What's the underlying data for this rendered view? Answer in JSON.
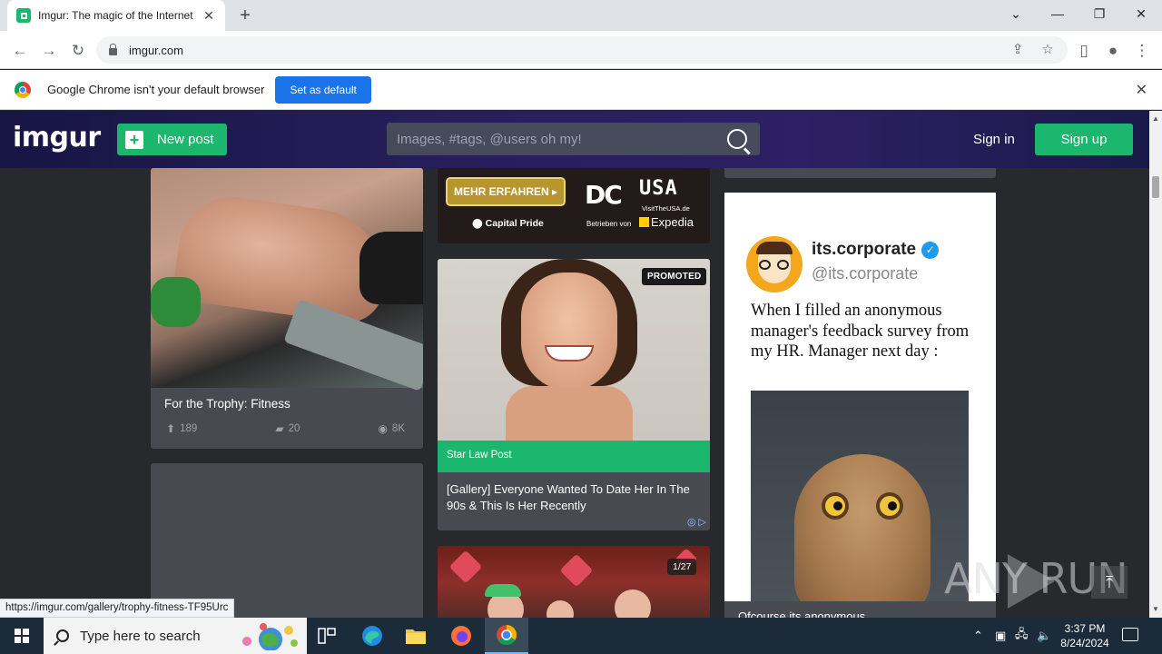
{
  "browser": {
    "tab_title": "Imgur: The magic of the Internet",
    "url": "imgur.com",
    "infobar_text": "Google Chrome isn't your default browser",
    "infobar_button": "Set as default",
    "status_url": "https://imgur.com/gallery/trophy-fitness-TF95Urc"
  },
  "imgur_header": {
    "logo": "imgur",
    "new_post_label": "New post",
    "search_placeholder": "Images, #tags, @users oh my!",
    "sign_in_label": "Sign in",
    "sign_up_label": "Sign up"
  },
  "posts": {
    "fitness": {
      "title": "For the Trophy: Fitness",
      "upvotes": "189",
      "comments": "20",
      "views": "8K"
    },
    "ad_banner": {
      "button_text": "MEHR ERFAHREN ▸",
      "location": "Capital Pride",
      "dc_text": "DC",
      "usa_text": "USA",
      "visit_text": "VisitTheUSA.de",
      "operated_by": "Betrieben von",
      "expedia": "Expedia"
    },
    "promoted": {
      "badge": "PROMOTED",
      "source": "Star Law Post",
      "title": "[Gallery] Everyone Wanted To Date Her In The 90s & This Is Her Recently"
    },
    "valentine": {
      "counter": "1/27"
    },
    "tweet": {
      "name": "its.corporate",
      "handle": "@its.corporate",
      "text": "When I filled an anonymous manager's feedback survey from my HR. Manager next day :",
      "caption": "Ofcourse its anonymous"
    }
  },
  "watermark": "ANY RUN",
  "taskbar": {
    "search_placeholder": "Type here to search",
    "time": "3:37 PM",
    "date": "8/24/2024"
  },
  "colors": {
    "imgur_green": "#1bb76e",
    "header_bg": "#261f5c",
    "page_bg": "#27292d",
    "card_bg": "#474a51",
    "chrome_blue": "#1a73e8"
  }
}
